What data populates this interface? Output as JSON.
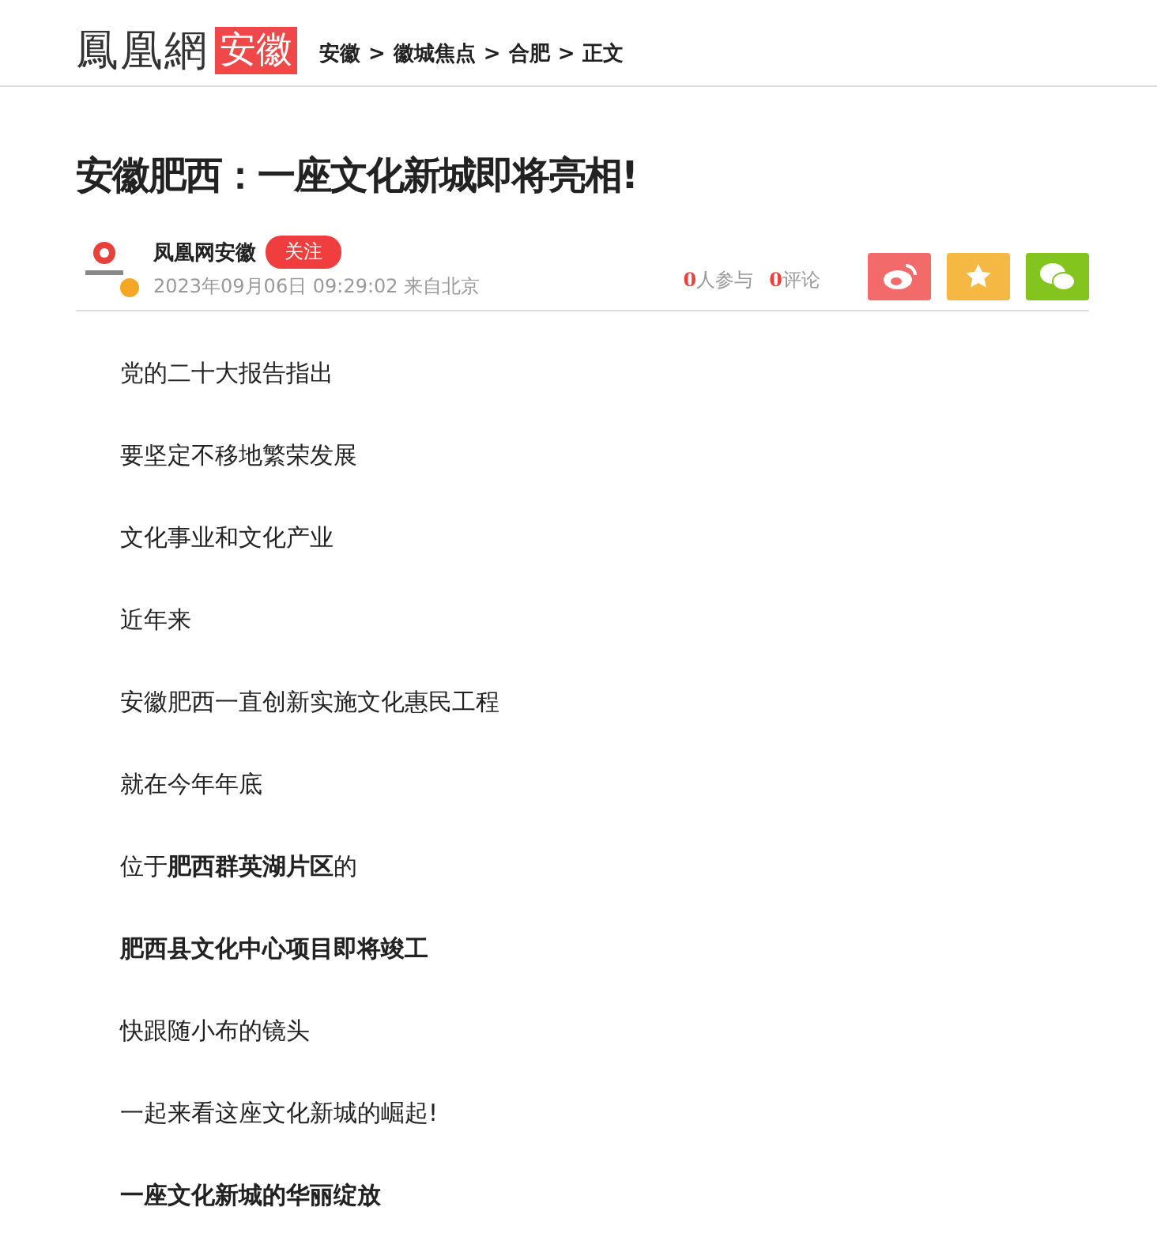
{
  "header": {
    "logo": "鳳凰網",
    "logo_region": "安徽",
    "breadcrumb": [
      {
        "label": "安徽"
      },
      {
        "label": "徽城焦点"
      },
      {
        "label": "合肥"
      },
      {
        "label": "正文"
      }
    ],
    "separator": ">"
  },
  "article": {
    "title": "安徽肥西：一座文化新城即将亮相!",
    "author": {
      "name": "凤凰网安徽",
      "verified": true,
      "follow": "关注",
      "meta": "2023年09月06日 09:29:02 来自北京"
    },
    "stats": [
      {
        "count": "0",
        "label": "人参与"
      },
      {
        "count": "0",
        "label": "评论"
      }
    ],
    "share": [
      {
        "kind": "weibo",
        "color": "#f36a6a"
      },
      {
        "kind": "favorite",
        "color": "#f5b843"
      },
      {
        "kind": "wechat",
        "color": "#83c51e"
      }
    ],
    "paragraphs": [
      {
        "text": "党的二十大报告指出",
        "bold": false
      },
      {
        "text": "要坚定不移地繁荣发展",
        "bold": false
      },
      {
        "text": "文化事业和文化产业",
        "bold": false
      },
      {
        "text": "近年来",
        "bold": false
      },
      {
        "text": "安徽肥西一直创新实施文化惠民工程",
        "bold": false
      },
      {
        "text": "就在今年年底",
        "bold": false
      },
      {
        "text": "位于**肥西群英湖片区**的",
        "bold": false
      },
      {
        "text": "肥西县文化中心项目即将竣工",
        "bold": true
      },
      {
        "text": "快跟随小布的镜头",
        "bold": false
      },
      {
        "text": "一起来看这座文化新城的崛起!",
        "bold": false
      },
      {
        "text": "一座文化新城的华丽绽放",
        "bold": true
      }
    ]
  }
}
